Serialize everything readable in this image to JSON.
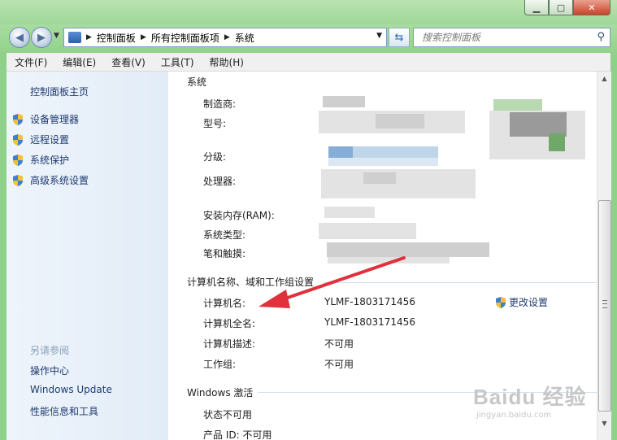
{
  "address": {
    "crumbs": [
      "控制面板",
      "所有控制面板项",
      "系统"
    ]
  },
  "search": {
    "placeholder": "搜索控制面板"
  },
  "menu": [
    "文件(F)",
    "编辑(E)",
    "查看(V)",
    "工具(T)",
    "帮助(H)"
  ],
  "sidebar": {
    "home": "控制面板主页",
    "items": [
      "设备管理器",
      "远程设置",
      "系统保护",
      "高级系统设置"
    ],
    "see_also_title": "另请参阅",
    "see_also": [
      "操作中心",
      "Windows Update",
      "性能信息和工具"
    ]
  },
  "system_section": {
    "title": "系统",
    "labels": [
      "制造商:",
      "型号:",
      "分级:",
      "处理器:",
      "安装内存(RAM):",
      "系统类型:",
      "笔和触摸:"
    ]
  },
  "computer_section": {
    "title": "计算机名称、域和工作组设置",
    "rows": [
      {
        "label": "计算机名:",
        "value": "YLMF-1803171456"
      },
      {
        "label": "计算机全名:",
        "value": "YLMF-1803171456"
      },
      {
        "label": "计算机描述:",
        "value": "不可用"
      },
      {
        "label": "工作组:",
        "value": "不可用"
      }
    ],
    "change_link": "更改设置"
  },
  "activation_section": {
    "title": "Windows 激活",
    "status": "状态不可用",
    "product_id": "产品 ID: 不可用"
  },
  "watermark": {
    "brand": "Baidu 经验",
    "url": "jingyan.baidu.com"
  },
  "colors": {
    "titlebar": "#a6dc9f",
    "sidebar": "#e6eef8",
    "link": "#1e3a6e",
    "arrow": "#e0313d"
  }
}
